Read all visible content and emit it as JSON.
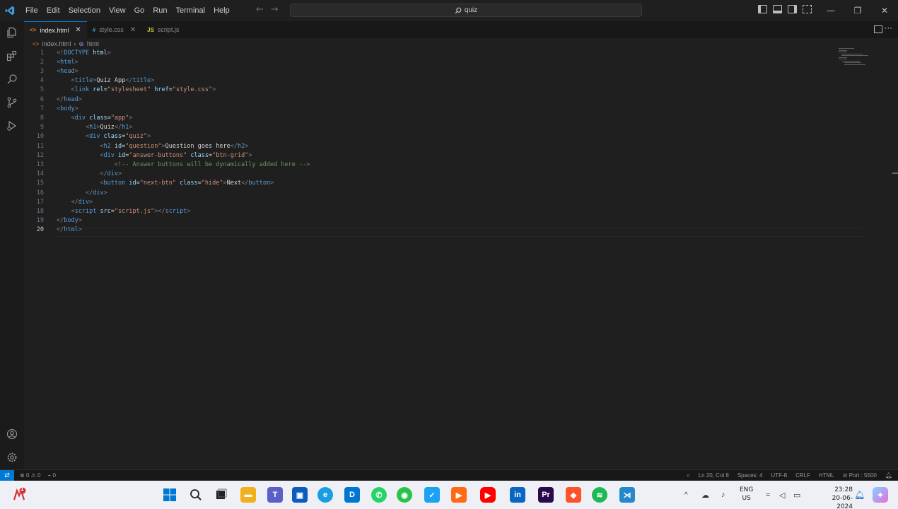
{
  "titlebar": {
    "menu": [
      "File",
      "Edit",
      "Selection",
      "View",
      "Go",
      "Run",
      "Terminal",
      "Help"
    ],
    "search": "quiz"
  },
  "tabs": [
    {
      "label": "index.html",
      "icon": "<>",
      "active": true
    },
    {
      "label": "style.css",
      "icon": "#",
      "active": false
    },
    {
      "label": "script.js",
      "icon": "JS",
      "active": false
    }
  ],
  "breadcrumb": {
    "file": "index.html",
    "node": "html"
  },
  "editor": {
    "current_line": 20,
    "lines": [
      [
        [
          "t-tag",
          "<!"
        ],
        [
          "t-doc",
          "DOCTYPE"
        ],
        [
          "t-attr",
          " html"
        ],
        [
          "t-tag",
          ">"
        ]
      ],
      [
        [
          "t-tag",
          "<"
        ],
        [
          "t-name",
          "html"
        ],
        [
          "t-tag",
          ">"
        ]
      ],
      [
        [
          "t-tag",
          "<"
        ],
        [
          "t-name",
          "head"
        ],
        [
          "t-tag",
          ">"
        ]
      ],
      [
        [
          "t-text",
          "    "
        ],
        [
          "t-tag",
          "<"
        ],
        [
          "t-name",
          "title"
        ],
        [
          "t-tag",
          ">"
        ],
        [
          "t-text",
          "Quiz App"
        ],
        [
          "t-tag",
          "</"
        ],
        [
          "t-name",
          "title"
        ],
        [
          "t-tag",
          ">"
        ]
      ],
      [
        [
          "t-text",
          "    "
        ],
        [
          "t-tag",
          "<"
        ],
        [
          "t-name",
          "link"
        ],
        [
          "t-attr",
          " rel"
        ],
        [
          "t-text",
          "="
        ],
        [
          "t-str",
          "\"stylesheet\""
        ],
        [
          "t-attr",
          " href"
        ],
        [
          "t-text",
          "="
        ],
        [
          "t-str",
          "\"style.css\""
        ],
        [
          "t-tag",
          ">"
        ]
      ],
      [
        [
          "t-tag",
          "</"
        ],
        [
          "t-name",
          "head"
        ],
        [
          "t-tag",
          ">"
        ]
      ],
      [
        [
          "t-tag",
          "<"
        ],
        [
          "t-name",
          "body"
        ],
        [
          "t-tag",
          ">"
        ]
      ],
      [
        [
          "t-text",
          "    "
        ],
        [
          "t-tag",
          "<"
        ],
        [
          "t-name",
          "div"
        ],
        [
          "t-attr",
          " class"
        ],
        [
          "t-text",
          "="
        ],
        [
          "t-str",
          "\"app\""
        ],
        [
          "t-tag",
          ">"
        ]
      ],
      [
        [
          "t-text",
          "        "
        ],
        [
          "t-tag",
          "<"
        ],
        [
          "t-name",
          "h1"
        ],
        [
          "t-tag",
          ">"
        ],
        [
          "t-text",
          "Quiz"
        ],
        [
          "t-tag",
          "</"
        ],
        [
          "t-name",
          "h1"
        ],
        [
          "t-tag",
          ">"
        ]
      ],
      [
        [
          "t-text",
          "        "
        ],
        [
          "t-tag",
          "<"
        ],
        [
          "t-name",
          "div"
        ],
        [
          "t-attr",
          " class"
        ],
        [
          "t-text",
          "="
        ],
        [
          "t-str",
          "\"quiz\""
        ],
        [
          "t-tag",
          ">"
        ]
      ],
      [
        [
          "t-text",
          "            "
        ],
        [
          "t-tag",
          "<"
        ],
        [
          "t-name",
          "h2"
        ],
        [
          "t-attr",
          " id"
        ],
        [
          "t-text",
          "="
        ],
        [
          "t-str",
          "\"question\""
        ],
        [
          "t-tag",
          ">"
        ],
        [
          "t-text",
          "Question goes here"
        ],
        [
          "t-tag",
          "</"
        ],
        [
          "t-name",
          "h2"
        ],
        [
          "t-tag",
          ">"
        ]
      ],
      [
        [
          "t-text",
          "            "
        ],
        [
          "t-tag",
          "<"
        ],
        [
          "t-name",
          "div"
        ],
        [
          "t-attr",
          " id"
        ],
        [
          "t-text",
          "="
        ],
        [
          "t-str",
          "\"answer-buttons\""
        ],
        [
          "t-attr",
          " class"
        ],
        [
          "t-text",
          "="
        ],
        [
          "t-str",
          "\"btn-grid\""
        ],
        [
          "t-tag",
          ">"
        ]
      ],
      [
        [
          "t-text",
          "                "
        ],
        [
          "t-com",
          "<!-- Answer buttons will be dynamically added here -->"
        ]
      ],
      [
        [
          "t-text",
          "            "
        ],
        [
          "t-tag",
          "</"
        ],
        [
          "t-name",
          "div"
        ],
        [
          "t-tag",
          ">"
        ]
      ],
      [
        [
          "t-text",
          "            "
        ],
        [
          "t-tag",
          "<"
        ],
        [
          "t-name",
          "button"
        ],
        [
          "t-attr",
          " id"
        ],
        [
          "t-text",
          "="
        ],
        [
          "t-str",
          "\"next-btn\""
        ],
        [
          "t-attr",
          " class"
        ],
        [
          "t-text",
          "="
        ],
        [
          "t-str",
          "\"hide\""
        ],
        [
          "t-tag",
          ">"
        ],
        [
          "t-text",
          "Next"
        ],
        [
          "t-tag",
          "</"
        ],
        [
          "t-name",
          "button"
        ],
        [
          "t-tag",
          ">"
        ]
      ],
      [
        [
          "t-text",
          "        "
        ],
        [
          "t-tag",
          "</"
        ],
        [
          "t-name",
          "div"
        ],
        [
          "t-tag",
          ">"
        ]
      ],
      [
        [
          "t-text",
          "    "
        ],
        [
          "t-tag",
          "</"
        ],
        [
          "t-name",
          "div"
        ],
        [
          "t-tag",
          ">"
        ]
      ],
      [
        [
          "t-text",
          "    "
        ],
        [
          "t-tag",
          "<"
        ],
        [
          "t-name",
          "script"
        ],
        [
          "t-attr",
          " src"
        ],
        [
          "t-text",
          "="
        ],
        [
          "t-str",
          "\"script.js\""
        ],
        [
          "t-tag",
          "></"
        ],
        [
          "t-name",
          "script"
        ],
        [
          "t-tag",
          ">"
        ]
      ],
      [
        [
          "t-tag",
          "</"
        ],
        [
          "t-name",
          "body"
        ],
        [
          "t-tag",
          ">"
        ]
      ],
      [
        [
          "t-tag",
          "</"
        ],
        [
          "t-name",
          "html"
        ],
        [
          "t-tag",
          ">"
        ]
      ]
    ]
  },
  "statusbar": {
    "errors": "0",
    "warnings": "0",
    "ports": "0",
    "position": "Ln 20, Col 8",
    "spaces": "Spaces: 4",
    "encoding": "UTF-8",
    "eol": "CRLF",
    "language": "HTML",
    "port": "Port : 5500"
  },
  "taskbar": {
    "lang_top": "ENG",
    "lang_bottom": "US",
    "time": "23:28",
    "date": "20-06-2024",
    "notif_badge": "1"
  }
}
